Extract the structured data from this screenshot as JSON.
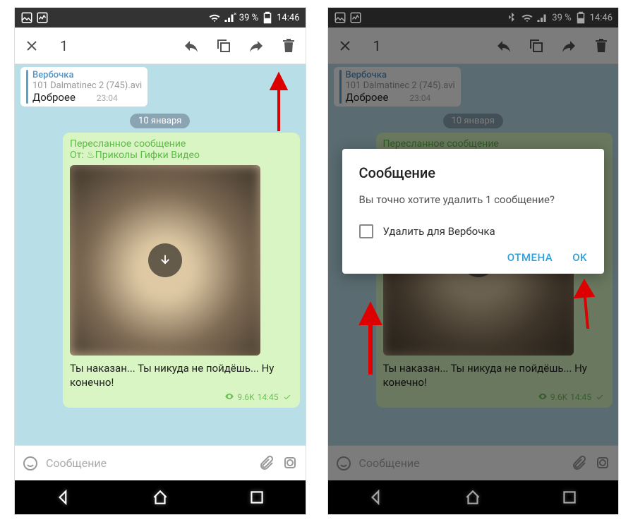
{
  "status": {
    "battery": "39 %",
    "time": "14:46"
  },
  "actionbar": {
    "count": "1"
  },
  "reply": {
    "name": "Вербочка",
    "file": "101 Dalmatinec 2 (745).avi",
    "text": "Доброее",
    "time": "23:04"
  },
  "date": "10 января",
  "fwd": {
    "label": "Пересланное сообщение",
    "from_prefix": "От: ",
    "from_name": "♨Приколы Гифки Видео"
  },
  "caption": "Ты наказан... Ты никуда не пойдёшь... Ну конечно!",
  "meta": {
    "views": "9.6K",
    "time": "14:45"
  },
  "input": {
    "placeholder": "Сообщение"
  },
  "dialog": {
    "title": "Сообщение",
    "body": "Вы точно хотите удалить 1 сообщение?",
    "checkbox": "Удалить для Вербочка",
    "cancel": "ОТМЕНА",
    "ok": "OK"
  }
}
